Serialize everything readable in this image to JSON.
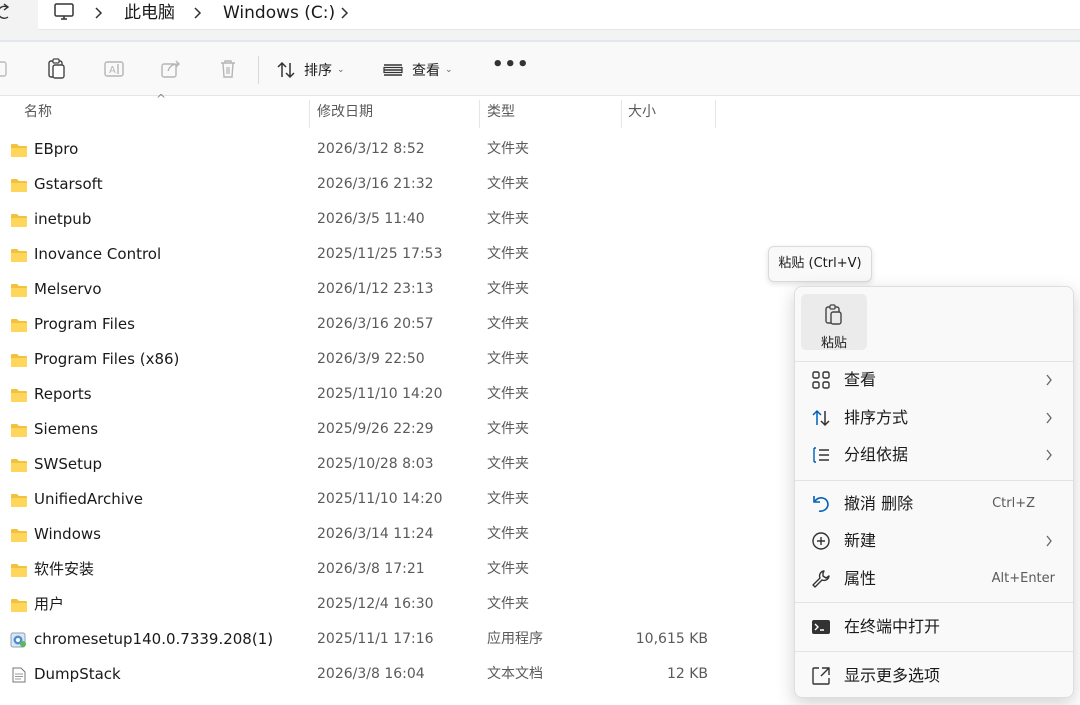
{
  "breadcrumb": {
    "items": [
      "此电脑",
      "Windows (C:)"
    ]
  },
  "toolbar": {
    "sort_label": "排序",
    "view_label": "查看",
    "more_label": "•••"
  },
  "columns": {
    "name": "名称",
    "modified": "修改日期",
    "type": "类型",
    "size": "大小"
  },
  "files": [
    {
      "name": "EBpro",
      "date": "2026/3/12 8:52",
      "type": "文件夹",
      "size": "",
      "icon": "folder-icon"
    },
    {
      "name": "Gstarsoft",
      "date": "2026/3/16 21:32",
      "type": "文件夹",
      "size": "",
      "icon": "folder-icon"
    },
    {
      "name": "inetpub",
      "date": "2026/3/5 11:40",
      "type": "文件夹",
      "size": "",
      "icon": "folder-icon"
    },
    {
      "name": "Inovance Control",
      "date": "2025/11/25 17:53",
      "type": "文件夹",
      "size": "",
      "icon": "folder-icon"
    },
    {
      "name": "Melservo",
      "date": "2026/1/12 23:13",
      "type": "文件夹",
      "size": "",
      "icon": "folder-icon"
    },
    {
      "name": "Program Files",
      "date": "2026/3/16 20:57",
      "type": "文件夹",
      "size": "",
      "icon": "folder-icon"
    },
    {
      "name": "Program Files (x86)",
      "date": "2026/3/9 22:50",
      "type": "文件夹",
      "size": "",
      "icon": "folder-icon"
    },
    {
      "name": "Reports",
      "date": "2025/11/10 14:20",
      "type": "文件夹",
      "size": "",
      "icon": "folder-icon"
    },
    {
      "name": "Siemens",
      "date": "2025/9/26 22:29",
      "type": "文件夹",
      "size": "",
      "icon": "folder-icon"
    },
    {
      "name": "SWSetup",
      "date": "2025/10/28 8:03",
      "type": "文件夹",
      "size": "",
      "icon": "folder-icon"
    },
    {
      "name": "UnifiedArchive",
      "date": "2025/11/10 14:20",
      "type": "文件夹",
      "size": "",
      "icon": "folder-icon"
    },
    {
      "name": "Windows",
      "date": "2026/3/14 11:24",
      "type": "文件夹",
      "size": "",
      "icon": "folder-icon"
    },
    {
      "name": "软件安装",
      "date": "2026/3/8 17:21",
      "type": "文件夹",
      "size": "",
      "icon": "folder-icon"
    },
    {
      "name": "用户",
      "date": "2025/12/4 16:30",
      "type": "文件夹",
      "size": "",
      "icon": "folder-icon"
    },
    {
      "name": "chromesetup140.0.7339.208(1)",
      "date": "2025/11/1 17:16",
      "type": "应用程序",
      "size": "10,615 KB",
      "icon": "installer-icon"
    },
    {
      "name": "DumpStack",
      "date": "2026/3/8 16:04",
      "type": "文本文档",
      "size": "12 KB",
      "icon": "text-file-icon"
    }
  ],
  "tooltip": {
    "text": "粘贴 (Ctrl+V)"
  },
  "context_menu": {
    "paste_label": "粘贴",
    "items": [
      {
        "label": "查看",
        "accel": "",
        "submenu": true,
        "icon": "grid-icon"
      },
      {
        "label": "排序方式",
        "accel": "",
        "submenu": true,
        "icon": "sort-icon"
      },
      {
        "label": "分组依据",
        "accel": "",
        "submenu": true,
        "icon": "group-icon"
      },
      {
        "label": "撤消 删除",
        "accel": "Ctrl+Z",
        "submenu": false,
        "icon": "undo-icon"
      },
      {
        "label": "新建",
        "accel": "",
        "submenu": true,
        "icon": "new-icon"
      },
      {
        "label": "属性",
        "accel": "Alt+Enter",
        "submenu": false,
        "icon": "wrench-icon"
      },
      {
        "label": "在终端中打开",
        "accel": "",
        "submenu": false,
        "icon": "terminal-icon"
      },
      {
        "label": "显示更多选项",
        "accel": "",
        "submenu": false,
        "icon": "more-options-icon"
      }
    ]
  },
  "colors": {
    "folder": "#f3c23c",
    "accent": "#005fb8",
    "menu_bg": "#f9f9f9"
  }
}
